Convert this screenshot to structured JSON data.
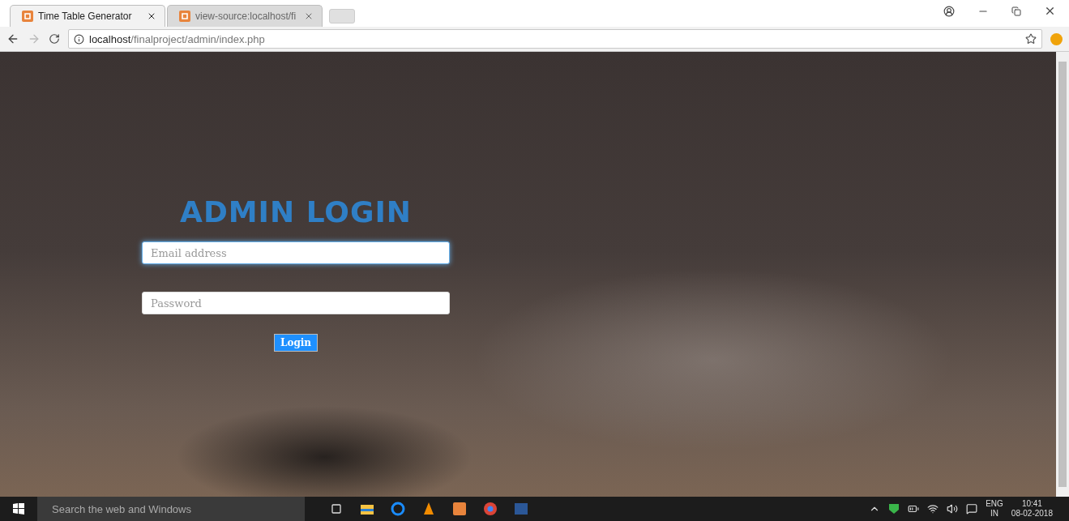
{
  "browser": {
    "tabs": [
      {
        "title": "Time Table Generator",
        "selected": true
      },
      {
        "title": "view-source:localhost/fi",
        "selected": false
      }
    ],
    "address": {
      "host": "localhost",
      "path": "/finalproject/admin/index.php"
    }
  },
  "page": {
    "heading": "ADMIN LOGIN",
    "fields": [
      {
        "placeholder": "Email address",
        "focused": true
      },
      {
        "placeholder": "Password",
        "focused": false
      }
    ],
    "button": "Login"
  },
  "taskbar": {
    "search_placeholder": "Search the web and Windows",
    "language": "ENG",
    "region": "IN",
    "time": "10:41",
    "date": "08-02-2018"
  }
}
